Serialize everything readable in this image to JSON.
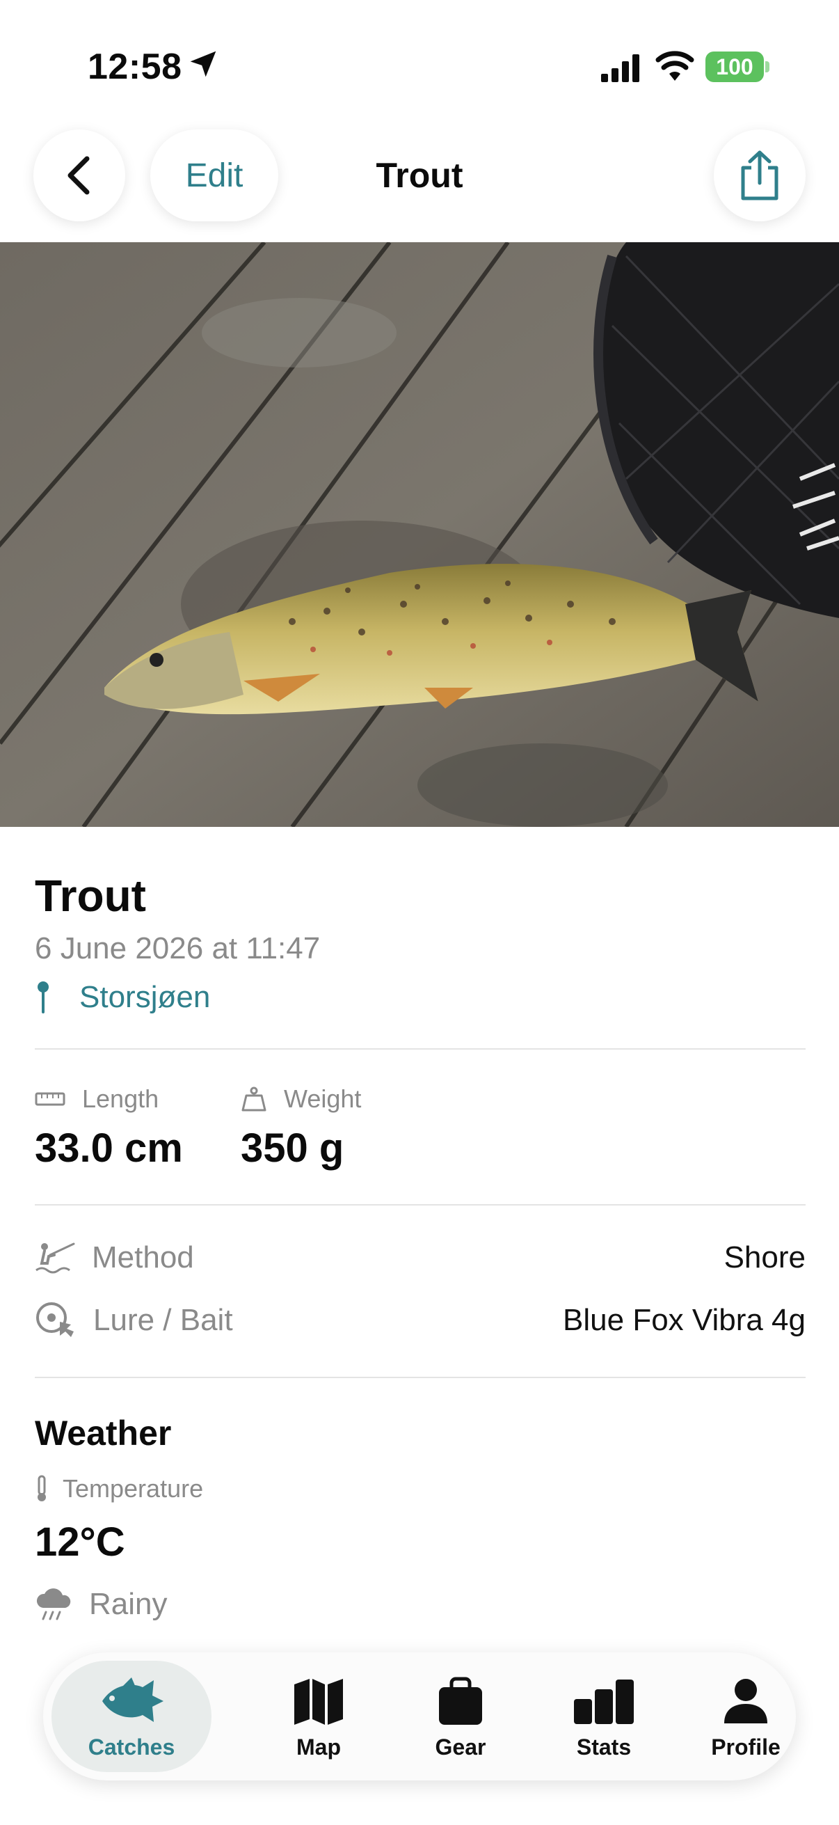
{
  "status_bar": {
    "time": "12:58",
    "battery": "100"
  },
  "nav": {
    "edit_label": "Edit",
    "title": "Trout"
  },
  "catch": {
    "species": "Trout",
    "datetime": "6 June 2026 at 11:47",
    "location": "Storsjøen"
  },
  "measurements": {
    "length_label": "Length",
    "length_value": "33.0 cm",
    "weight_label": "Weight",
    "weight_value": "350 g"
  },
  "details": [
    {
      "label": "Method",
      "value": "Shore",
      "icon": "fisherman-icon"
    },
    {
      "label": "Lure / Bait",
      "value": "Blue Fox Vibra 4g",
      "icon": "lure-icon"
    }
  ],
  "weather": {
    "heading": "Weather",
    "temp_label": "Temperature",
    "temp_value": "12°C",
    "condition": "Rainy"
  },
  "tabs": [
    {
      "label": "Catches",
      "icon": "fish-icon",
      "active": true
    },
    {
      "label": "Map",
      "icon": "map-icon"
    },
    {
      "label": "Gear",
      "icon": "bag-icon"
    },
    {
      "label": "Stats",
      "icon": "bars-icon"
    },
    {
      "label": "Profile",
      "icon": "person-icon"
    }
  ],
  "colors": {
    "accent": "#2f7f8b",
    "muted": "#8a8a8a",
    "battery": "#5cc15e"
  }
}
